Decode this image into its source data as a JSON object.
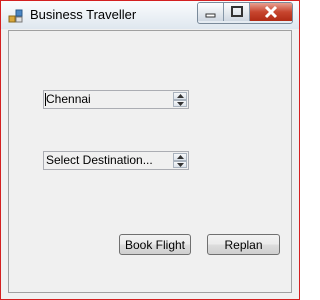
{
  "window": {
    "title": "Business Traveller",
    "icon": "app-form-icon",
    "caption_buttons": [
      "minimize-icon",
      "maximize-icon",
      "close-icon"
    ]
  },
  "origin_spinner": {
    "value": "Chennai"
  },
  "destination_spinner": {
    "value": "Select Destination..."
  },
  "buttons": {
    "book_flight": "Book Flight",
    "replan": "Replan"
  },
  "colors": {
    "window_border": "#d42020",
    "client_background": "#f0f0f0",
    "close_button": "#c7452e"
  }
}
